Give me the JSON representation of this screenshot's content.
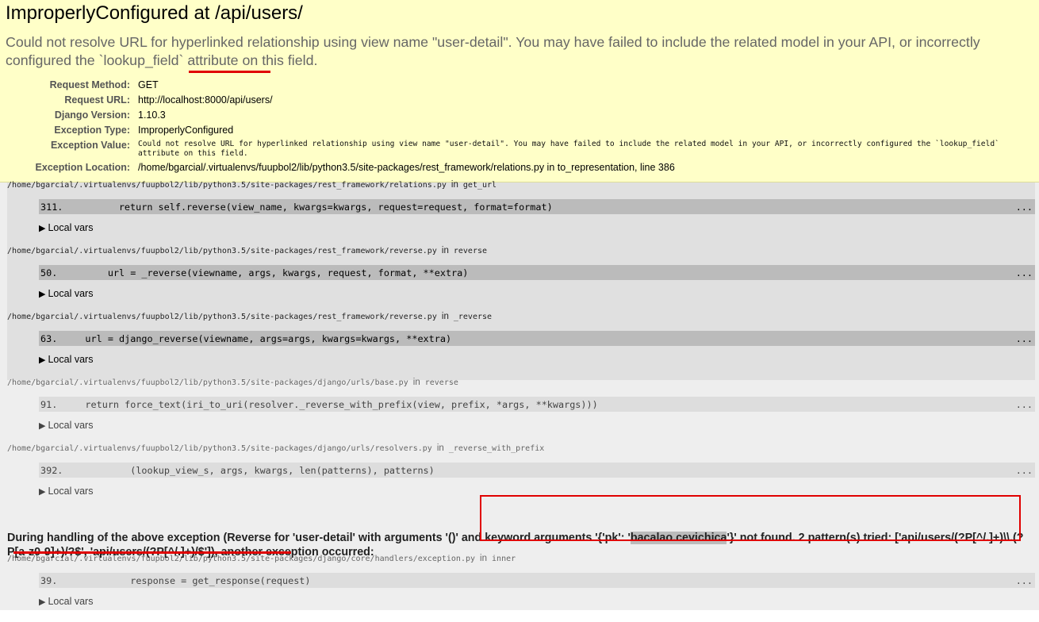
{
  "summary": {
    "title": "ImproperlyConfigured at /api/users/",
    "message": "Could not resolve URL for hyperlinked relationship using view name \"user-detail\". You may have failed to include the related model in your API, or incorrectly configured the `lookup_field` attribute on this field.",
    "meta": [
      {
        "label": "Request Method:",
        "value": "GET"
      },
      {
        "label": "Request URL:",
        "value": "http://localhost:8000/api/users/"
      },
      {
        "label": "Django Version:",
        "value": "1.10.3"
      },
      {
        "label": "Exception Type:",
        "value": "ImproperlyConfigured"
      },
      {
        "label": "Exception Value:",
        "value": "Could not resolve URL for hyperlinked relationship using view name \"user-detail\". You may have failed to include the related model in your API, or incorrectly configured the `lookup_field` attribute on this field."
      },
      {
        "label": "Exception Location:",
        "value": "/home/bgarcial/.virtualenvs/fuupbol2/lib/python3.5/site-packages/rest_framework/relations.py in to_representation, line 386"
      }
    ]
  },
  "frames": [
    {
      "path": "/home/bgarcial/.virtualenvs/fuupbol2/lib/python3.5/site-packages/rest_framework/relations.py",
      "in_label": "in",
      "func": "get_url",
      "line_no": "311.",
      "code": "        return self.reverse(view_name, kwargs=kwargs, request=request, format=format)",
      "dots": "...",
      "local_vars": "Local vars",
      "kind": "user"
    },
    {
      "path": "/home/bgarcial/.virtualenvs/fuupbol2/lib/python3.5/site-packages/rest_framework/reverse.py",
      "in_label": "in",
      "func": "reverse",
      "line_no": "50.",
      "code": "        url = _reverse(viewname, args, kwargs, request, format, **extra)",
      "dots": "...",
      "local_vars": "Local vars",
      "kind": "user"
    },
    {
      "path": "/home/bgarcial/.virtualenvs/fuupbol2/lib/python3.5/site-packages/rest_framework/reverse.py",
      "in_label": "in",
      "func": "_reverse",
      "line_no": "63.",
      "code": "    url = django_reverse(viewname, args=args, kwargs=kwargs, **extra)",
      "dots": "...",
      "local_vars": "Local vars",
      "kind": "user"
    },
    {
      "path": "/home/bgarcial/.virtualenvs/fuupbol2/lib/python3.5/site-packages/django/urls/base.py",
      "in_label": "in",
      "func": "reverse",
      "line_no": "91.",
      "code": "    return force_text(iri_to_uri(resolver._reverse_with_prefix(view, prefix, *args, **kwargs)))",
      "dots": "...",
      "local_vars": "Local vars",
      "kind": "lib"
    },
    {
      "path": "/home/bgarcial/.virtualenvs/fuupbol2/lib/python3.5/site-packages/django/urls/resolvers.py",
      "in_label": "in",
      "func": "_reverse_with_prefix",
      "line_no": "392.",
      "code": "            (lookup_view_s, args, kwargs, len(patterns), patterns)",
      "dots": "...",
      "local_vars": "Local vars",
      "kind": "lib"
    },
    {
      "path": "/home/bgarcial/.virtualenvs/fuupbol2/lib/python3.5/site-packages/django/core/handlers/exception.py",
      "in_label": "in",
      "func": "inner",
      "line_no": "39.",
      "code": "            response = get_response(request)",
      "dots": "...",
      "local_vars": "Local vars",
      "kind": "lib"
    }
  ],
  "handling": {
    "part1": "During handling of the above exception (Reverse for 'user-detail' with arguments '()' and keyword arguments '{'pk': '",
    "highlight": "bacalao.cevichica",
    "part2": "'}' not found. 2 pattern(s) tried: ['api/users/(?P[^/.]+)\\\\.(?P[a-z0-9]+)/?$', 'api/users/(?P[^/.]+)/$']), another exception occurred:"
  },
  "colors": {
    "summary_bg": "#ffffc8",
    "traceback_bg": "#eeeeee",
    "annotation_red": "#e00000"
  }
}
